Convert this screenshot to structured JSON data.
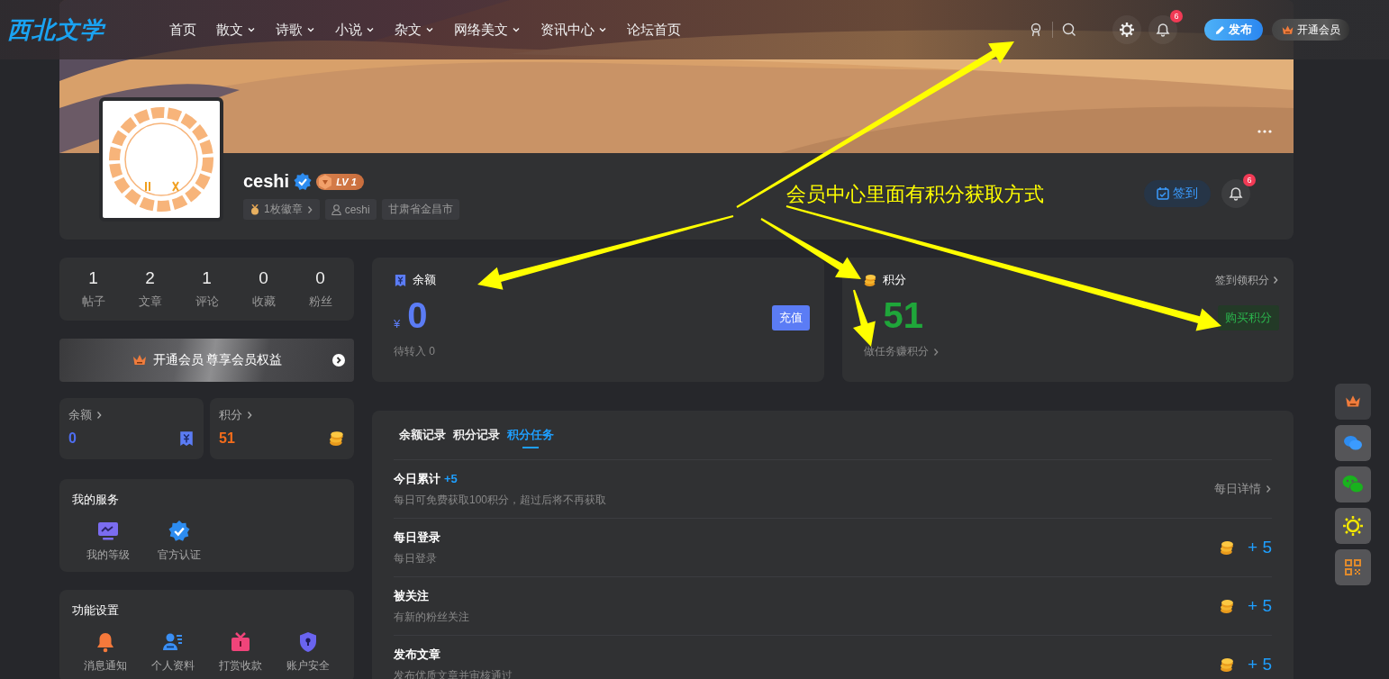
{
  "header": {
    "logo": "西北文学",
    "nav": [
      {
        "label": "首页",
        "has_dropdown": false
      },
      {
        "label": "散文",
        "has_dropdown": true
      },
      {
        "label": "诗歌",
        "has_dropdown": true
      },
      {
        "label": "小说",
        "has_dropdown": true
      },
      {
        "label": "杂文",
        "has_dropdown": true
      },
      {
        "label": "网络美文",
        "has_dropdown": true
      },
      {
        "label": "资讯中心",
        "has_dropdown": true
      },
      {
        "label": "论坛首页",
        "has_dropdown": false
      }
    ],
    "notification_count": "6",
    "publish_button": "发布",
    "vip_button": "开通会员"
  },
  "profile": {
    "name": "ceshi",
    "verified": true,
    "level": "LV 1",
    "tags": [
      {
        "kind": "badge",
        "label": "1枚徽章"
      },
      {
        "kind": "user",
        "label": "ceshi"
      },
      {
        "kind": "plain",
        "label": "甘肃省金昌市"
      }
    ],
    "checkin_button": "签到",
    "notification_count": "6"
  },
  "annotation": {
    "text": "会员中心里面有积分获取方式"
  },
  "stats": [
    {
      "value": "1",
      "label": "帖子"
    },
    {
      "value": "2",
      "label": "文章"
    },
    {
      "value": "1",
      "label": "评论"
    },
    {
      "value": "0",
      "label": "收藏"
    },
    {
      "value": "0",
      "label": "粉丝"
    }
  ],
  "vip_banner": {
    "text": "开通会员 尊享会员权益"
  },
  "wallet": [
    {
      "label": "余额",
      "value": "0",
      "color": "#4e6ef2"
    },
    {
      "label": "积分",
      "value": "51",
      "color": "#f56c1b"
    }
  ],
  "services": {
    "title": "我的服务",
    "items": [
      "我的等级",
      "官方认证"
    ]
  },
  "settings": {
    "title": "功能设置",
    "items": [
      "消息通知",
      "个人资料",
      "打赏收款",
      "账户安全"
    ]
  },
  "balance_card": {
    "title": "余额",
    "currency": "¥",
    "amount": "0",
    "button": "充值",
    "pending": "待转入 0"
  },
  "points_card": {
    "title": "积分",
    "link": "签到领积分",
    "amount": "51",
    "button": "购买积分",
    "tasks_link": "做任务赚积分"
  },
  "records": {
    "tabs": [
      {
        "label": "余额记录",
        "selected": false
      },
      {
        "label": "积分记录",
        "selected": false
      },
      {
        "label": "积分任务",
        "selected": true
      }
    ],
    "rows": [
      {
        "kind": "summary",
        "title": "今日累计",
        "bonus": "+5",
        "desc": "每日可免费获取100积分，超过后将不再获取",
        "link": "每日详情"
      },
      {
        "kind": "task",
        "title": "每日登录",
        "desc": "每日登录",
        "reward": "+ 5"
      },
      {
        "kind": "task",
        "title": "被关注",
        "desc": "有新的粉丝关注",
        "reward": "+ 5"
      },
      {
        "kind": "task",
        "title": "发布文章",
        "desc": "发布优质文章并审核通过",
        "reward": "+ 5"
      }
    ]
  }
}
